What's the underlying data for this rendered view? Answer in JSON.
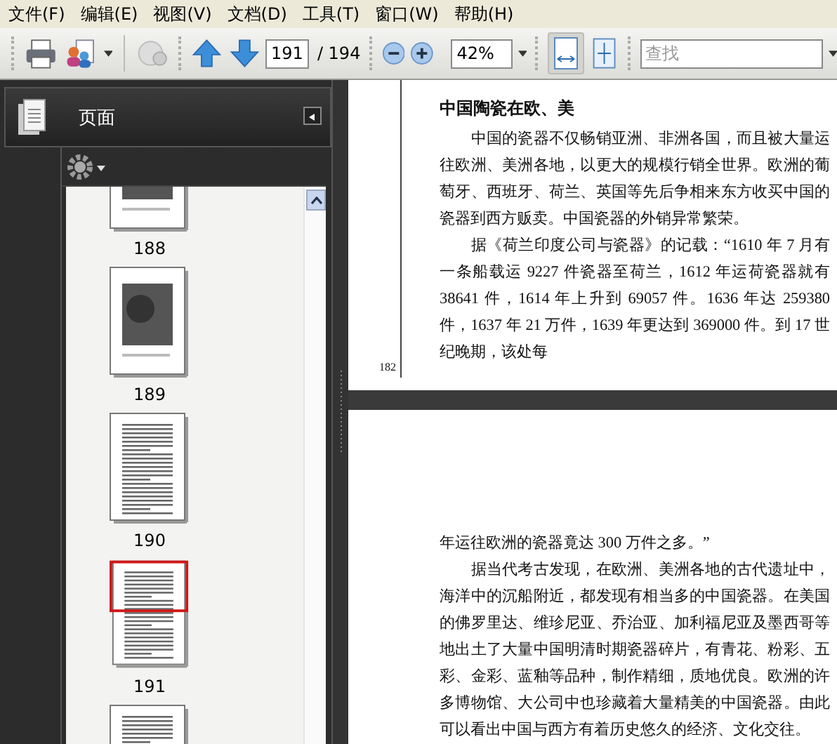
{
  "menu": [
    "文件(F)",
    "编辑(E)",
    "视图(V)",
    "文档(D)",
    "工具(T)",
    "窗口(W)",
    "帮助(H)"
  ],
  "toolbar": {
    "page_number": "191",
    "page_total": "/ 194",
    "zoom": "42%",
    "search": {
      "placeholder": "查找"
    },
    "fit_width_selected": true
  },
  "sidebar": {
    "title": "页面",
    "thumbnails": [
      {
        "label": "188",
        "kind": "photo",
        "selected": false
      },
      {
        "label": "189",
        "kind": "photo",
        "selected": false
      },
      {
        "label": "190",
        "kind": "text",
        "selected": false
      },
      {
        "label": "191",
        "kind": "text",
        "selected": true
      },
      {
        "kind": "text",
        "selected": false
      }
    ]
  },
  "document": {
    "pages": [
      {
        "heading": "中国陶瓷在欧、美",
        "paragraphs": [
          "中国的瓷器不仅畅销亚洲、非洲各国，而且被大量运往欧洲、美洲各地，以更大的规模行销全世界。欧洲的葡萄牙、西班牙、荷兰、英国等先后争相来东方收买中国的瓷器到西方贩卖。中国瓷器的外销异常繁荣。",
          "据《荷兰印度公司与瓷器》的记载：“1610 年 7 月有一条船载运 9227 件瓷器至荷兰，1612 年运荷瓷器就有 38641 件，1614 年上升到 69057 件。1636 年达 259380 件，1637 年 21 万件，1639 年更达到 369000 件。到 17 世纪晚期，该处每"
        ],
        "page_number": "182"
      },
      {
        "paragraphs": [
          "年运往欧洲的瓷器竟达 300 万件之多。”",
          "据当代考古发现，在欧洲、美洲各地的古代遗址中，海洋中的沉船附近，都发现有相当多的中国瓷器。在美国的佛罗里达、维珍尼亚、乔治亚、加利福尼亚及墨西哥等地出土了大量中国明清时期瓷器碎片，有青花、粉彩、五彩、金彩、蓝釉等品种，制作精细，质地优良。欧洲的许多博物馆、大公司中也珍藏着大量精美的中国瓷器。由此可以看出中国与西方有着历史悠久的经济、文化交往。"
        ]
      }
    ]
  }
}
